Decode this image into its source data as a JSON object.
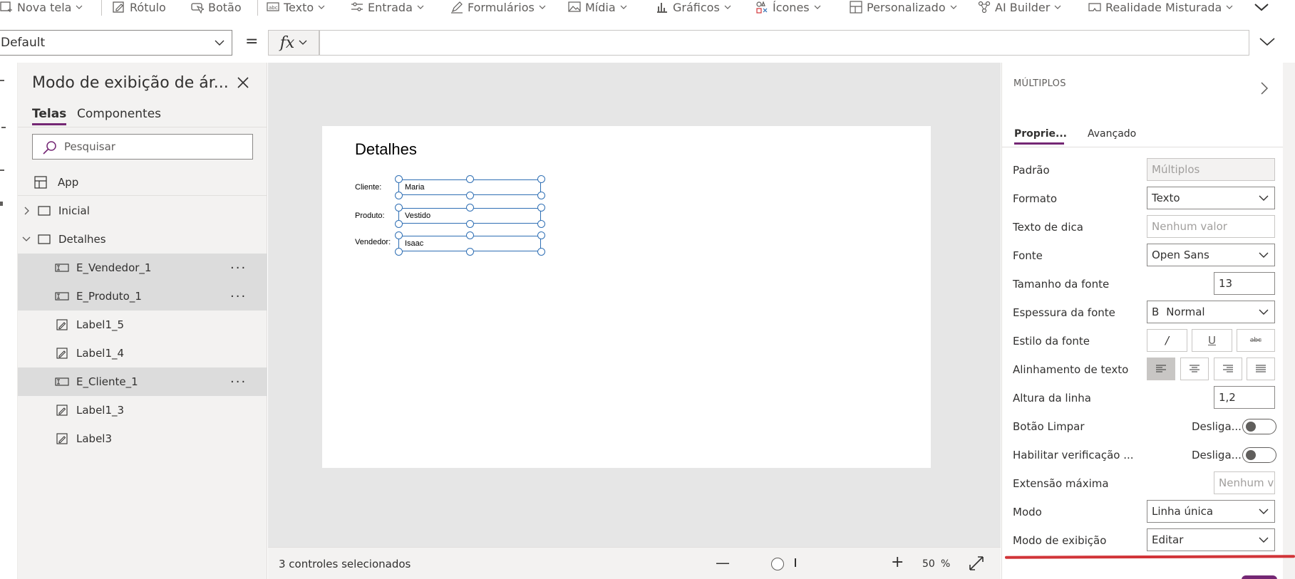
{
  "ribbon": {
    "items": [
      {
        "label": "Nova tela"
      },
      {
        "label": "Rótulo"
      },
      {
        "label": "Botão"
      },
      {
        "label": "Texto"
      },
      {
        "label": "Entrada"
      },
      {
        "label": "Formulários"
      },
      {
        "label": "Mídia"
      },
      {
        "label": "Gráficos"
      },
      {
        "label": "Ícones"
      },
      {
        "label": "Personalizado"
      },
      {
        "label": "AI Builder"
      },
      {
        "label": "Realidade Misturada"
      }
    ]
  },
  "formula_bar": {
    "property": "Default",
    "equals": "=",
    "fx": "fx",
    "formula": ""
  },
  "tree_view": {
    "title": "Modo de exibição de ár...",
    "tabs": [
      {
        "label": "Telas",
        "active": true
      },
      {
        "label": "Componentes",
        "active": false
      }
    ],
    "search_placeholder": "Pesquisar",
    "app_label": "App",
    "nodes": [
      {
        "label": "Inicial"
      },
      {
        "label": "Detalhes"
      },
      {
        "label": "E_Vendedor_1",
        "selected": true
      },
      {
        "label": "E_Produto_1",
        "selected": true
      },
      {
        "label": "Label1_5",
        "selected": false
      },
      {
        "label": "Label1_4",
        "selected": false
      },
      {
        "label": "E_Cliente_1",
        "selected": true
      },
      {
        "label": "Label1_3",
        "selected": false
      },
      {
        "label": "Label3",
        "selected": false
      }
    ],
    "more": "···"
  },
  "canvas": {
    "screen_title": "Detalhes",
    "fields": [
      {
        "label": "Cliente:",
        "value": "Maria"
      },
      {
        "label": "Produto:",
        "value": "Vestido"
      },
      {
        "label": "Vendedor:",
        "value": "Isaac"
      }
    ],
    "status": "3 controles selecionados",
    "zoom_value": "50",
    "zoom_unit": "%"
  },
  "properties": {
    "kind": "MÚLTIPLOS",
    "tabs": [
      {
        "label": "Proprie...",
        "active": true
      },
      {
        "label": "Avançado",
        "active": false
      }
    ],
    "rows": {
      "padrao": {
        "label": "Padrão",
        "value": "Múltiplos"
      },
      "formato": {
        "label": "Formato",
        "value": "Texto"
      },
      "dica": {
        "label": "Texto de dica",
        "placeholder": "Nenhum valor"
      },
      "fonte": {
        "label": "Fonte",
        "value": "Open Sans"
      },
      "tamanho": {
        "label": "Tamanho da fonte",
        "value": "13"
      },
      "espessura": {
        "label": "Espessura da fonte",
        "prefix": "B",
        "value": "Normal"
      },
      "estilo": {
        "label": "Estilo da fonte",
        "italic": "/",
        "underline": "U",
        "strike": "abc"
      },
      "alinhamento": {
        "label": "Alinhamento de texto"
      },
      "altura": {
        "label": "Altura da linha",
        "value": "1,2"
      },
      "limpar": {
        "label": "Botão Limpar",
        "state": "Desliga..."
      },
      "verificacao": {
        "label": "Habilitar verificação ...",
        "state": "Desliga..."
      },
      "extensao": {
        "label": "Extensão máxima",
        "placeholder": "Nenhum val"
      },
      "modo": {
        "label": "Modo",
        "value": "Linha única"
      },
      "modo_exibicao": {
        "label": "Modo de exibição",
        "value": "Editar"
      }
    }
  },
  "colors": {
    "accent": "#742774",
    "selection": "#2f6fb4",
    "highlight": "#d13438"
  }
}
